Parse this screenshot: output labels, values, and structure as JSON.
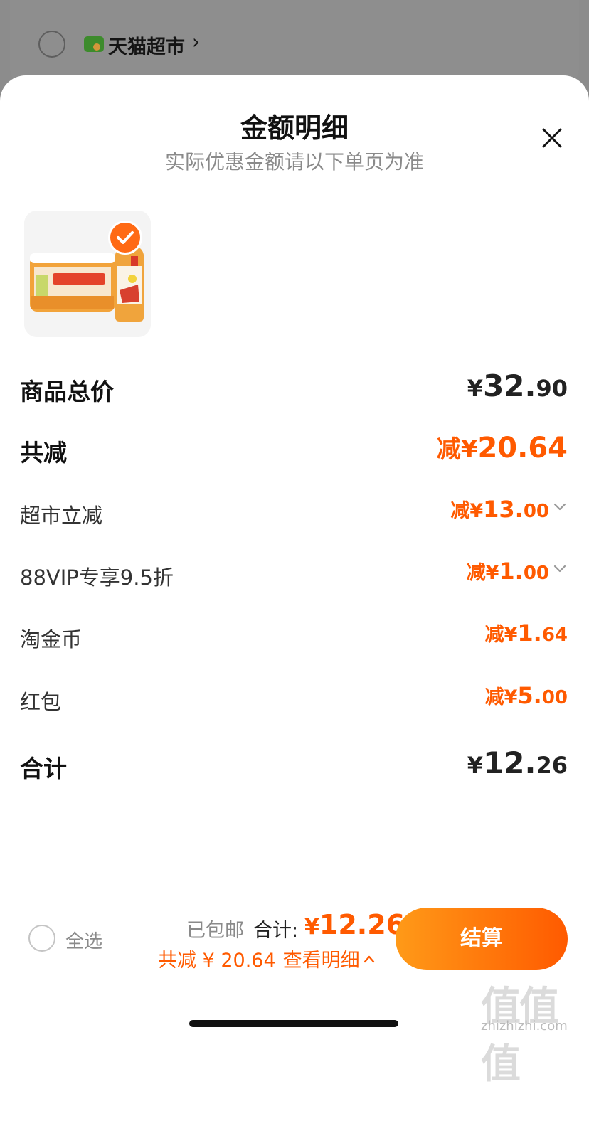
{
  "store": {
    "name": "天猫超市",
    "chevron": "›"
  },
  "sheet": {
    "title": "金额明细",
    "subtitle": "实际优惠金额请以下单页为准",
    "close_icon": "close-icon"
  },
  "product": {
    "selected": true,
    "image": "bottled-tea-pack-image"
  },
  "details": {
    "total_price": {
      "label": "商品总价",
      "yen": "¥",
      "int": "32.",
      "dec": "90"
    },
    "total_reduce": {
      "label": "共减",
      "prefix": "减",
      "yen": "¥",
      "int": "20.",
      "dec": "64"
    },
    "supermarket_discount": {
      "label": "超市立减",
      "prefix": "减",
      "yen": "¥",
      "int": "13.",
      "dec": "00",
      "expandable": true
    },
    "vip_discount": {
      "label": "88VIP专享9.5折",
      "prefix": "减",
      "yen": "¥",
      "int": "1.",
      "dec": "00",
      "expandable": true
    },
    "coins": {
      "label": "淘金币",
      "prefix": "减",
      "yen": "¥",
      "int": "1.",
      "dec": "64"
    },
    "red_packet": {
      "label": "红包",
      "prefix": "减",
      "yen": "¥",
      "int": "5.",
      "dec": "00"
    },
    "sum": {
      "label": "合计",
      "yen": "¥",
      "int": "12.",
      "dec": "26"
    }
  },
  "bottom_bar": {
    "select_all": "全选",
    "shipping": "已包邮",
    "total_label": "合计:",
    "total_yen": "¥",
    "total_value": "12.26",
    "discount_text": "共减 ¥ 20.64",
    "detail_link": "查看明细",
    "checkout": "结算"
  },
  "watermark": {
    "main": "值值值",
    "url": "zhizhizhi.com"
  },
  "colors": {
    "accent": "#ff5a00",
    "button_gradient_start": "#ff9a18",
    "button_gradient_end": "#ff5a00",
    "text_dark": "#222222",
    "text_muted": "#8a8a8a"
  }
}
